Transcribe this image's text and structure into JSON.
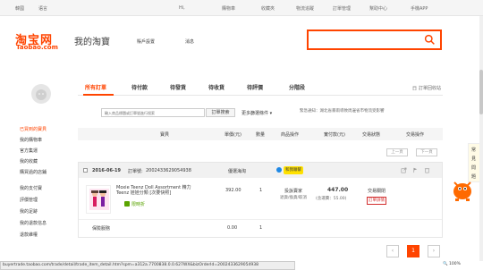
{
  "topbar": {
    "region": "韓國",
    "language": "语言",
    "user": "Hi,",
    "cart": "購物車",
    "favorites": "收藏夾",
    "logistics": "物流追蹤",
    "seller_manage": "訂單管理",
    "help": "幫助中心",
    "mobile_app": "手機APP"
  },
  "header": {
    "logo_cn": "淘宝网",
    "logo_en": "Taobao.com",
    "title": "我的淘寶",
    "account_settings": "賬戶設置",
    "messages": "消息"
  },
  "sidebar": {
    "items": [
      {
        "label": "已買到的寶貝",
        "active": true
      },
      {
        "label": "我的購物車",
        "active": false
      },
      {
        "label": "官方集運",
        "active": false
      },
      {
        "label": "我的收藏",
        "active": false
      },
      {
        "label": "購買過的店鋪",
        "active": false
      },
      {
        "label": "我的支付寶",
        "active": false
      },
      {
        "label": "評價管理",
        "active": false
      },
      {
        "label": "我的足跡",
        "active": false
      },
      {
        "label": "我的退款信息",
        "active": false
      },
      {
        "label": "退款維權",
        "active": false
      }
    ]
  },
  "tabs": [
    {
      "label": "所有訂單",
      "active": true
    },
    {
      "label": "待付款",
      "active": false
    },
    {
      "label": "待發貨",
      "active": false
    },
    {
      "label": "待收貨",
      "active": false
    },
    {
      "label": "待評價",
      "active": false
    },
    {
      "label": "分階段",
      "active": false
    }
  ],
  "recycle_bin": "訂單回收站",
  "filter": {
    "placeholder": "輸入商品標題或訂單號進行搜索",
    "search_button": "訂單搜索",
    "more": "更多篩選條件",
    "notice": "緊急通知：湖北省暴雨導致周邊省市物流受影響"
  },
  "table_headers": {
    "product": "寶貝",
    "price": "單價(元)",
    "qty": "數量",
    "actions": "商品操作",
    "paid": "實付款(元)",
    "status": "交易狀態",
    "op": "交易操作"
  },
  "pager_top": {
    "prev": "上一頁",
    "next": "下一頁"
  },
  "order": {
    "date": "2016-06-19",
    "order_no_label": "訂單號:",
    "order_no": "2002433629054938",
    "shop": "優選海淘",
    "chat_label": "和我聯繫",
    "product_title": "Moxie Teenz Doll Assortment 精力Teenz 娃娃分類 [次要快照]",
    "promo_label": "限時折",
    "price": "392.00",
    "qty": "1",
    "action1": "投訴賣家",
    "action2": "退貨/換貨/取消",
    "paid": "447.00",
    "shipping": "(含運費：55.00)",
    "status": "交易關閉",
    "detail": "訂單詳情",
    "service_label": "保險服務",
    "service_price": "0.00",
    "service_qty": "1"
  },
  "float_widget": {
    "chars": [
      "常",
      "見",
      "問",
      "題"
    ]
  },
  "pagination": {
    "prev": "‹",
    "current": "1",
    "next": "›"
  },
  "statusbar": {
    "url": "buyertrade.taobao.com/trade/detail/trade_item_detail.htm?spm=a312a.7700838.0.0.627WX&bizOrderId=2002433629054938",
    "zoom": "100%"
  },
  "colors": {
    "accent": "#ff4400",
    "detail_border": "#d32f2f"
  }
}
